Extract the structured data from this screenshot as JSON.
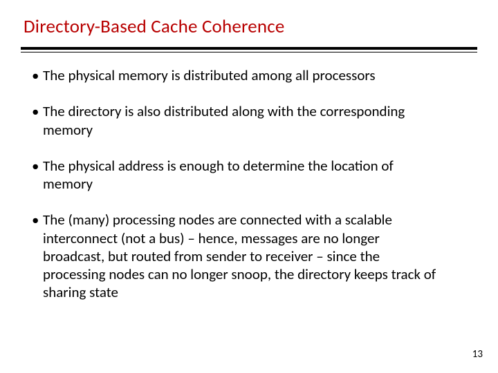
{
  "slide": {
    "title": "Directory-Based Cache Coherence",
    "bullets": [
      "The physical memory is distributed among all processors",
      "The directory is also distributed along with the corresponding memory",
      "The physical address is enough to determine the location of memory",
      "The (many) processing nodes are connected with a scalable interconnect (not a bus) – hence, messages are no longer broadcast, but routed from sender to receiver – since the processing nodes can no longer snoop, the directory keeps track of sharing state"
    ],
    "page_number": "13",
    "bullet_glyph": "•"
  }
}
